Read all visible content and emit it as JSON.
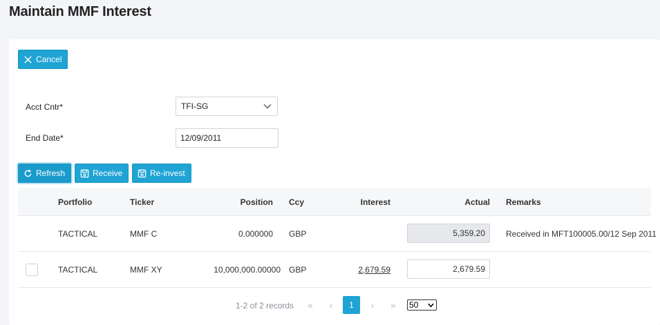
{
  "page": {
    "title": "Maintain MMF Interest"
  },
  "toolbar": {
    "cancel_label": "Cancel"
  },
  "form": {
    "acct_cntr_label": "Acct Cntr*",
    "acct_cntr_value": "TFI-SG",
    "end_date_label": "End Date*",
    "end_date_value": "12/09/2011"
  },
  "actions": {
    "refresh_label": "Refresh",
    "receive_label": "Receive",
    "reinvest_label": "Re-invest"
  },
  "grid": {
    "columns": {
      "portfolio": "Portfolio",
      "ticker": "Ticker",
      "position": "Position",
      "ccy": "Ccy",
      "interest": "Interest",
      "actual": "Actual",
      "remarks": "Remarks"
    },
    "rows": [
      {
        "portfolio": "TACTICAL",
        "ticker": "MMF C",
        "position": "0.000000",
        "ccy": "GBP",
        "interest": "",
        "actual": "5,359.20",
        "remarks": "Received in MFT100005.00/12 Sep 2011"
      },
      {
        "portfolio": "TACTICAL",
        "ticker": "MMF XY",
        "position": "10,000,000.00000",
        "ccy": "GBP",
        "interest": "2,679.59",
        "actual": "2,679.59",
        "remarks": ""
      }
    ]
  },
  "pagination": {
    "records_text": "1-2 of 2 records",
    "first": "«",
    "prev": "‹",
    "current_page": "1",
    "next": "›",
    "last": "»",
    "page_size": "50"
  },
  "colors": {
    "accent": "#1fa4d4",
    "background": "#f3f5f8",
    "disabled_input": "#e6e8eb"
  },
  "icons": [
    "close-icon",
    "chevron-down-icon",
    "refresh-icon",
    "save-icon"
  ]
}
